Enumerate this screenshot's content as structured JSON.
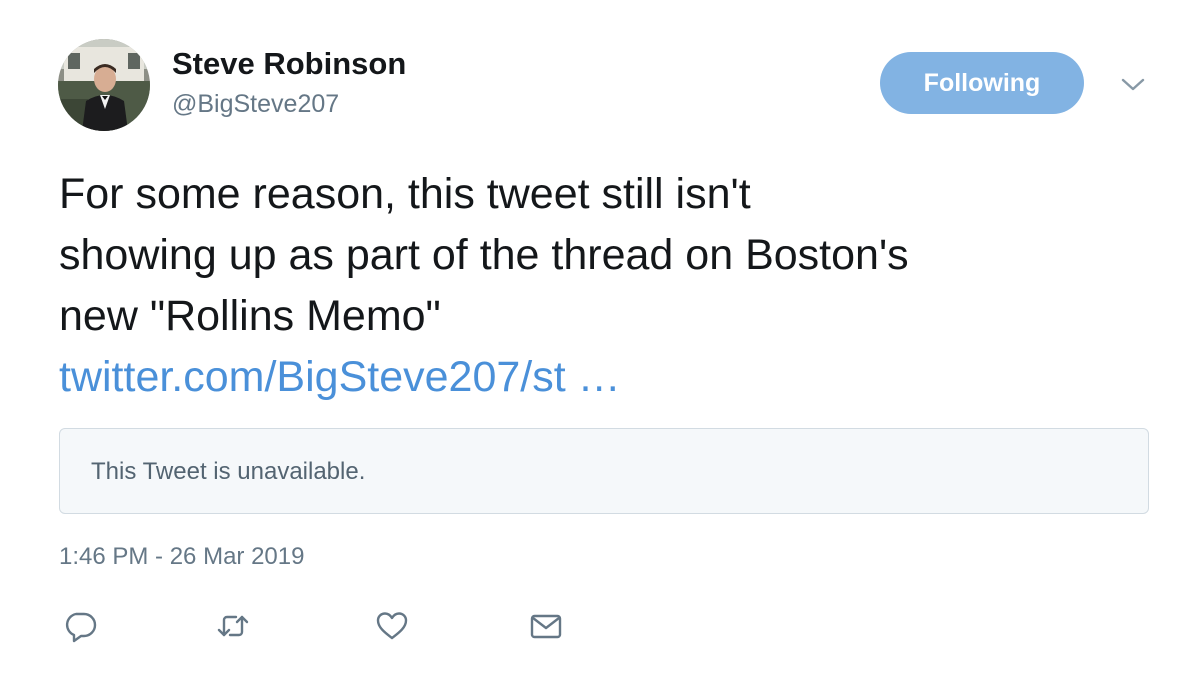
{
  "author": {
    "display_name": "Steve Robinson",
    "handle": "@BigSteve207"
  },
  "follow_button": {
    "label": "Following",
    "color": "#82b3e3"
  },
  "menu": {
    "icon": "chevron-down-icon"
  },
  "tweet": {
    "text_lines": [
      "For some reason, this tweet still isn't",
      "showing up as part of the thread on Boston's",
      "new \"Rollins Memo\""
    ],
    "link_text": "twitter.com/BigSteve207/st …",
    "link_color": "#4a90d9"
  },
  "quoted_tweet": {
    "message": "This Tweet is unavailable."
  },
  "timestamp": "1:46 PM - 26 Mar 2019",
  "actions": [
    {
      "name": "reply",
      "icon": "reply-icon"
    },
    {
      "name": "retweet",
      "icon": "retweet-icon"
    },
    {
      "name": "like",
      "icon": "heart-icon"
    },
    {
      "name": "direct-message",
      "icon": "envelope-icon"
    }
  ]
}
